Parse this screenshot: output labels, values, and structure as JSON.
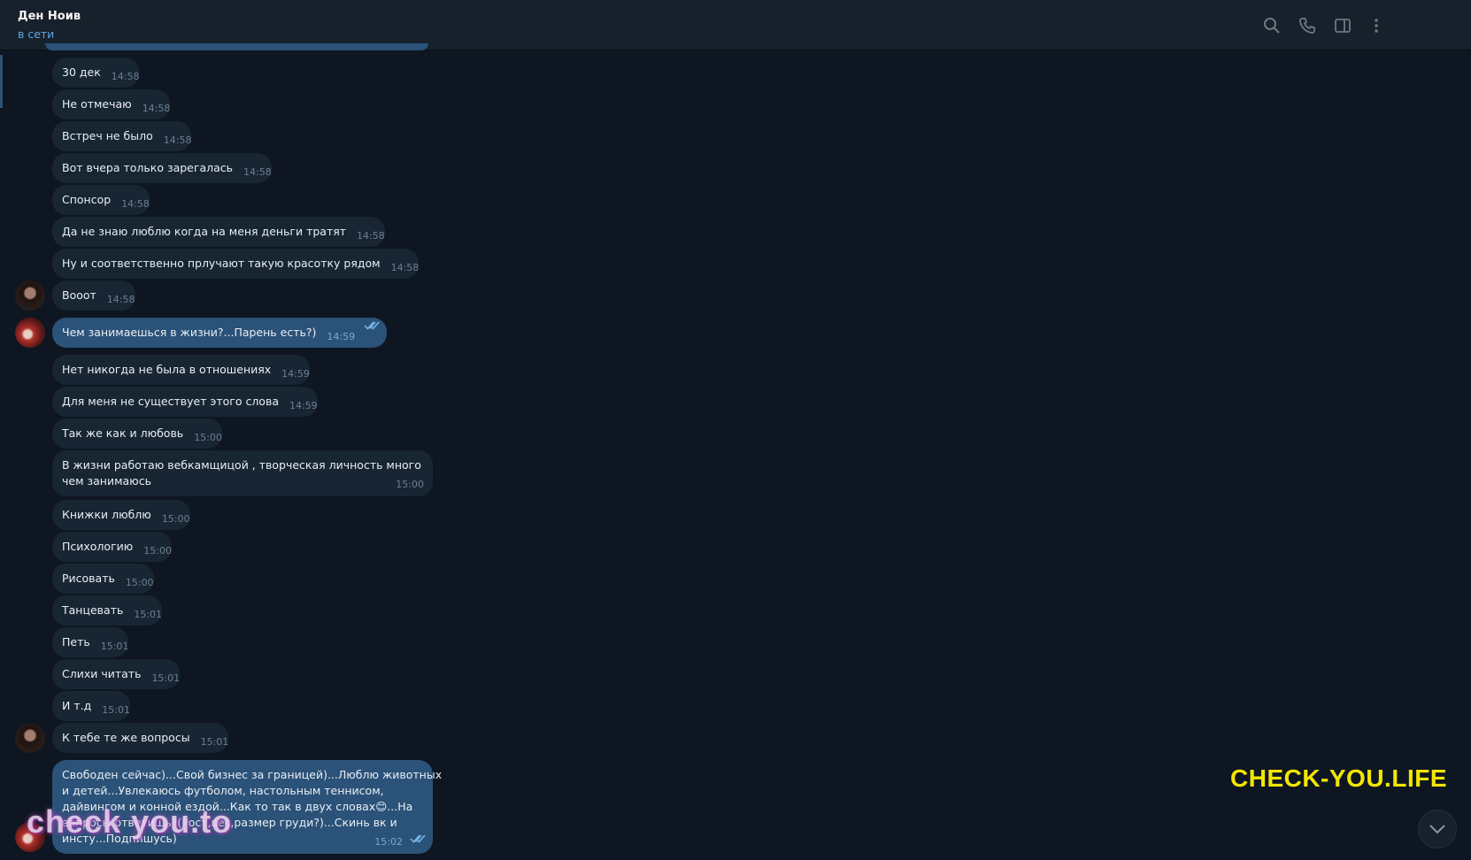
{
  "header": {
    "contact_name": "Ден Ноив",
    "status": "в сети",
    "icons": [
      "search-icon",
      "phone-icon",
      "sidebar-toggle-icon",
      "more-vertical-icon"
    ]
  },
  "messages": [
    {
      "text": "30 дек",
      "time": "14:58",
      "dir": "in"
    },
    {
      "text": "Не отмечаю",
      "time": "14:58",
      "dir": "in"
    },
    {
      "text": "Встреч не было",
      "time": "14:58",
      "dir": "in"
    },
    {
      "text": "Вот вчера только зарегалась",
      "time": "14:58",
      "dir": "in"
    },
    {
      "text": "Спонсор",
      "time": "14:58",
      "dir": "in"
    },
    {
      "text": "Да не знаю люблю когда на меня деньги тратят",
      "time": "14:58",
      "dir": "in"
    },
    {
      "text": "Ну и соответственно прлучают такую красотку рядом",
      "time": "14:58",
      "dir": "in"
    },
    {
      "text": "Вооот",
      "time": "14:58",
      "dir": "in"
    },
    {
      "text": "Чем занимаешься в жизни?...Парень есть?)",
      "time": "14:59",
      "dir": "out"
    },
    {
      "text": "Нет никогда не была в отношениях",
      "time": "14:59",
      "dir": "in"
    },
    {
      "text": "Для меня не существует этого слова",
      "time": "14:59",
      "dir": "in"
    },
    {
      "text": "Так же как и любовь",
      "time": "15:00",
      "dir": "in"
    },
    {
      "text": "В жизни работаю вебкамщицой , творческая личность много чем занимаюсь",
      "time": "15:00",
      "dir": "in"
    },
    {
      "text": "Книжки люблю",
      "time": "15:00",
      "dir": "in"
    },
    {
      "text": "Психологию",
      "time": "15:00",
      "dir": "in"
    },
    {
      "text": "Рисовать",
      "time": "15:00",
      "dir": "in"
    },
    {
      "text": "Танцевать",
      "time": "15:01",
      "dir": "in"
    },
    {
      "text": "Петь",
      "time": "15:01",
      "dir": "in"
    },
    {
      "text": "Слихи читать",
      "time": "15:01",
      "dir": "in"
    },
    {
      "text": "И т.д",
      "time": "15:01",
      "dir": "in"
    },
    {
      "text": "К тебе те же вопросы",
      "time": "15:01",
      "dir": "in"
    },
    {
      "text": "Свободен сейчас)...Свой бизнес за границей)...Люблю животных и детей...Увлекаюсь футболом, настольным теннисом, дайвингом и конной ездой...Как то так в двух словах😊...На вопросы ответишь?(Рост,вес,размер груди?)...Скинь вк и инсту...Подпишусь)",
      "time": "15:02",
      "dir": "out"
    }
  ],
  "multiline_texts": {
    "m12": [
      "В жизни работаю вебкамщицой , творческая личность много",
      "чем занимаюсь"
    ],
    "m21": [
      "Свободен сейчас)...Свой бизнес за границей)...Люблю животных",
      "и детей...Увлекаюсь футболом, настольным теннисом,",
      "дайвингом и конной ездой...Как то так в двух словах😊...На",
      "вопросы ответишь?(Рост,вес,размер груди?)...Скинь вк и",
      "инсту...Подпишусь)"
    ]
  },
  "overlays": {
    "brand_text": "CHECK-YOU.LIFE",
    "watermark_text": "check you.to"
  },
  "colors": {
    "background": "#0e1621",
    "header": "#17212b",
    "incoming_bubble": "#182533",
    "outgoing_bubble": "#2b5278",
    "status_blue": "#5ea9e8",
    "brand_yellow": "#f2e600"
  }
}
